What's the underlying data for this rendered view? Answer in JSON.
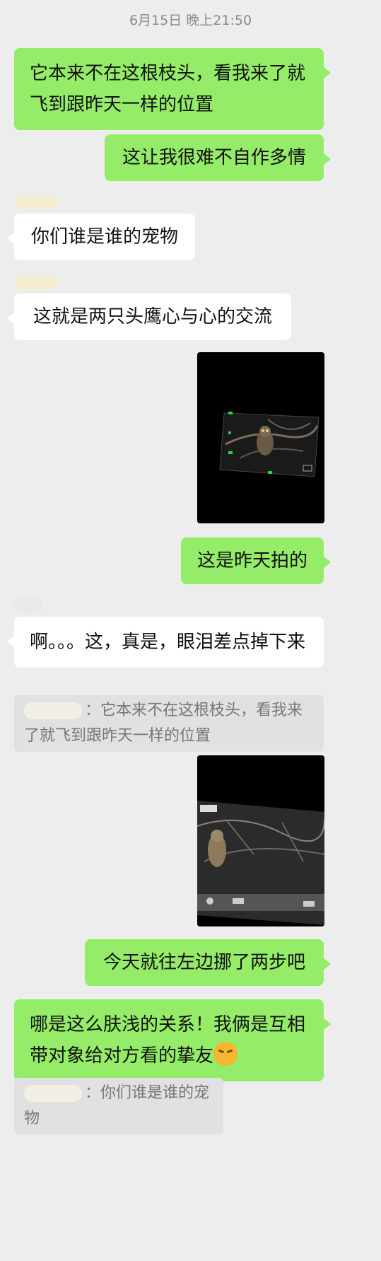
{
  "timestamp": "6月15日 晚上21:50",
  "messages": {
    "m1": "它本来不在这根枝头，看我来了就飞到跟昨天一样的位置",
    "m2": "这让我很难不自作多情",
    "m3": "你们谁是谁的宠物",
    "m4": "这就是两只头鹰心与心的交流",
    "m6": "这是昨天拍的",
    "m7": "啊。。。这，真是，眼泪差点掉下来",
    "m9": "今天就往左边挪了两步吧",
    "m10": "哪是这么肤浅的关系！我俩是互相带对象给对方看的挚友"
  },
  "quotes": {
    "q1": "：它本来不在这根枝头，看我来了就飞到跟昨天一样的位置",
    "q2": "：你们谁是谁的宠物"
  },
  "photos": {
    "photo1_icon": "owl-photo-night",
    "photo2_icon": "owl-photo-screen"
  },
  "emoji": {
    "name": "shy-emoji"
  },
  "colors": {
    "background": "#ededed",
    "self_bubble": "#95ec69",
    "other_bubble": "#ffffff",
    "quote_bg": "#e1e1e1"
  }
}
